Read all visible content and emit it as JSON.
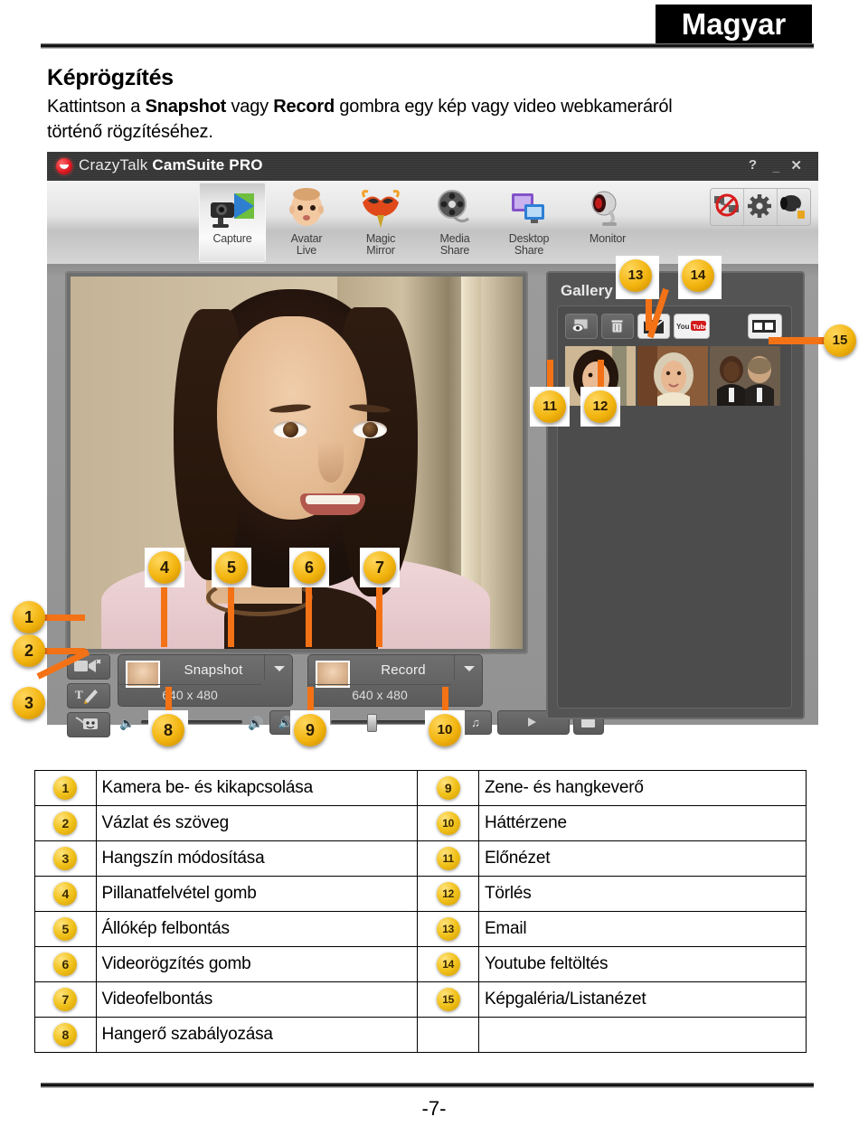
{
  "document": {
    "language_banner": "Magyar",
    "title": "Képrögzítés",
    "intro_part1": "Kattintson a ",
    "intro_bold1": "Snapshot",
    "intro_part2": " vagy ",
    "intro_bold2": "Record",
    "intro_part3": " gombra egy kép vagy video webkameráról történő rögzítéséhez.",
    "page_number": "-7-"
  },
  "app": {
    "title_plain": "CrazyTalk ",
    "title_bold": "CamSuite PRO",
    "window_buttons": {
      "help": "?",
      "minimize": "_",
      "close": "✕"
    },
    "toolbar": {
      "items": [
        {
          "label_line1": "Capture",
          "label_line2": "",
          "icon": "camera-capture-icon",
          "active": true
        },
        {
          "label_line1": "Avatar",
          "label_line2": "Live",
          "icon": "avatar-face-icon",
          "active": false
        },
        {
          "label_line1": "Magic",
          "label_line2": "Mirror",
          "icon": "carnival-mask-icon",
          "active": false
        },
        {
          "label_line1": "Media",
          "label_line2": "Share",
          "icon": "film-reel-icon",
          "active": false
        },
        {
          "label_line1": "Desktop",
          "label_line2": "Share",
          "icon": "monitor-share-icon",
          "active": false
        },
        {
          "label_line1": "Monitor",
          "label_line2": "",
          "icon": "webcam-monitor-icon",
          "active": false
        }
      ],
      "right_buttons": [
        {
          "icon": "network-disconnect-icon"
        },
        {
          "icon": "gear-icon"
        },
        {
          "icon": "camera-settings-icon"
        }
      ]
    },
    "capture": {
      "snapshot_label": "Snapshot",
      "snapshot_resolution": "640 x 480",
      "record_label": "Record",
      "record_resolution": "640 x 480"
    },
    "gallery": {
      "title": "Gallery",
      "buttons": [
        {
          "icon": "preview-icon",
          "name": "preview"
        },
        {
          "icon": "trash-icon",
          "name": "delete"
        },
        {
          "icon": "envelope-icon",
          "name": "email"
        },
        {
          "icon": "youtube-icon",
          "name": "youtube",
          "label": "YouTube"
        },
        {
          "icon": "list-view-icon",
          "name": "view-mode"
        }
      ],
      "thumbnails": [
        {
          "name": "thumbnail-1"
        },
        {
          "name": "thumbnail-2"
        },
        {
          "name": "thumbnail-3"
        }
      ]
    }
  },
  "callouts": [
    {
      "n": "1"
    },
    {
      "n": "2"
    },
    {
      "n": "3"
    },
    {
      "n": "4"
    },
    {
      "n": "5"
    },
    {
      "n": "6"
    },
    {
      "n": "7"
    },
    {
      "n": "8"
    },
    {
      "n": "9"
    },
    {
      "n": "10"
    },
    {
      "n": "11"
    },
    {
      "n": "12"
    },
    {
      "n": "13"
    },
    {
      "n": "14"
    },
    {
      "n": "15"
    }
  ],
  "legend": {
    "rows": [
      {
        "left_num": "1",
        "left_text": "Kamera be- és kikapcsolása",
        "right_num": "9",
        "right_text": "Zene- és hangkeverő"
      },
      {
        "left_num": "2",
        "left_text": "Vázlat és szöveg",
        "right_num": "10",
        "right_text": "Háttérzene"
      },
      {
        "left_num": "3",
        "left_text": "Hangszín módosítása",
        "right_num": "11",
        "right_text": "Előnézet"
      },
      {
        "left_num": "4",
        "left_text": "Pillanatfelvétel gomb",
        "right_num": "12",
        "right_text": "Törlés"
      },
      {
        "left_num": "5",
        "left_text": "Állókép felbontás",
        "right_num": "13",
        "right_text": "Email"
      },
      {
        "left_num": "6",
        "left_text": "Videorögzítés gomb",
        "right_num": "14",
        "right_text": "Youtube feltöltés"
      },
      {
        "left_num": "7",
        "left_text": "Videofelbontás",
        "right_num": "15",
        "right_text": "Képgaléria/Listanézet"
      },
      {
        "left_num": "8",
        "left_text": "Hangerő szabályozása",
        "right_num": "",
        "right_text": ""
      }
    ]
  },
  "colors": {
    "callout": "#f2b40e",
    "leader": "#f47216",
    "banner_bg": "#000000"
  }
}
